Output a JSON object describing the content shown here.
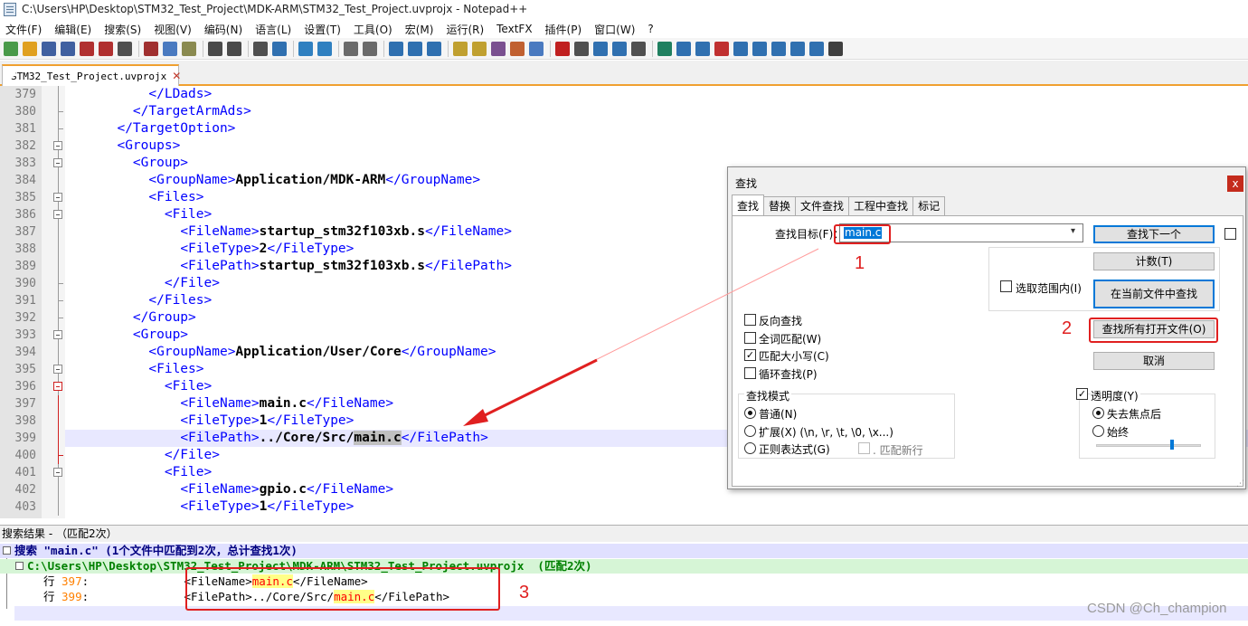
{
  "window": {
    "title": "C:\\Users\\HP\\Desktop\\STM32_Test_Project\\MDK-ARM\\STM32_Test_Project.uvprojx - Notepad++"
  },
  "menu": [
    "文件(F)",
    "编辑(E)",
    "搜索(S)",
    "视图(V)",
    "编码(N)",
    "语言(L)",
    "设置(T)",
    "工具(O)",
    "宏(M)",
    "运行(R)",
    "TextFX",
    "插件(P)",
    "窗口(W)",
    "?"
  ],
  "toolbar_icons": [
    "new-file-icon",
    "open-folder-icon",
    "save-icon",
    "save-all-icon",
    "close-icon",
    "close-all-icon",
    "print-icon",
    "cut-icon",
    "copy-icon",
    "paste-icon",
    "undo-icon",
    "redo-icon",
    "find-icon",
    "replace-icon",
    "zoom-in-icon",
    "zoom-out-icon",
    "sync-v-icon",
    "sync-h-icon",
    "wrap-icon",
    "all-chars-icon",
    "indent-guide-icon",
    "udl-icon",
    "doc-map-icon",
    "function-list-icon",
    "folder-as-workspace-icon",
    "monitor-icon",
    "record-macro-icon",
    "stop-macro-icon",
    "play-macro-icon",
    "run-macro-icon",
    "save-macro-icon",
    "plugin-icon",
    "insert-icon",
    "list-icon",
    "list2-icon",
    "collapse-icon",
    "up-icon",
    "down-icon",
    "sort-icon",
    "columns-icon",
    "hex-icon"
  ],
  "tab": {
    "label": "STM32_Test_Project.uvprojx"
  },
  "editor": {
    "lines": [
      {
        "num": "379",
        "indent": "      ",
        "pre": "",
        "open": "</LDads>",
        "text": "",
        "close": ""
      },
      {
        "num": "380",
        "indent": "    ",
        "pre": "",
        "open": "</TargetArmAds>",
        "text": "",
        "close": ""
      },
      {
        "num": "381",
        "indent": "  ",
        "pre": "",
        "open": "</TargetOption>",
        "text": "",
        "close": ""
      },
      {
        "num": "382",
        "indent": "  ",
        "pre": "",
        "open": "<Groups>",
        "text": "",
        "close": ""
      },
      {
        "num": "383",
        "indent": "    ",
        "pre": "",
        "open": "<Group>",
        "text": "",
        "close": ""
      },
      {
        "num": "384",
        "indent": "      ",
        "pre": "",
        "open": "<GroupName>",
        "text": "Application/MDK-ARM",
        "close": "</GroupName>"
      },
      {
        "num": "385",
        "indent": "      ",
        "pre": "",
        "open": "<Files>",
        "text": "",
        "close": ""
      },
      {
        "num": "386",
        "indent": "        ",
        "pre": "",
        "open": "<File>",
        "text": "",
        "close": ""
      },
      {
        "num": "387",
        "indent": "          ",
        "pre": "",
        "open": "<FileName>",
        "text": "startup_stm32f103xb.s",
        "close": "</FileName>"
      },
      {
        "num": "388",
        "indent": "          ",
        "pre": "",
        "open": "<FileType>",
        "text": "2",
        "close": "</FileType>"
      },
      {
        "num": "389",
        "indent": "          ",
        "pre": "",
        "open": "<FilePath>",
        "text": "startup_stm32f103xb.s",
        "close": "</FilePath>"
      },
      {
        "num": "390",
        "indent": "        ",
        "pre": "",
        "open": "</File>",
        "text": "",
        "close": ""
      },
      {
        "num": "391",
        "indent": "      ",
        "pre": "",
        "open": "</Files>",
        "text": "",
        "close": ""
      },
      {
        "num": "392",
        "indent": "    ",
        "pre": "",
        "open": "</Group>",
        "text": "",
        "close": ""
      },
      {
        "num": "393",
        "indent": "    ",
        "pre": "",
        "open": "<Group>",
        "text": "",
        "close": ""
      },
      {
        "num": "394",
        "indent": "      ",
        "pre": "",
        "open": "<GroupName>",
        "text": "Application/User/Core",
        "close": "</GroupName>"
      },
      {
        "num": "395",
        "indent": "      ",
        "pre": "",
        "open": "<Files>",
        "text": "",
        "close": ""
      },
      {
        "num": "396",
        "indent": "        ",
        "pre": "",
        "open": "<File>",
        "text": "",
        "close": ""
      },
      {
        "num": "397",
        "indent": "          ",
        "pre": "",
        "open": "<FileName>",
        "text": "main.c",
        "close": "</FileName>"
      },
      {
        "num": "398",
        "indent": "          ",
        "pre": "",
        "open": "<FileType>",
        "text": "1",
        "close": "</FileType>"
      },
      {
        "num": "399",
        "indent": "          ",
        "pre": "",
        "open": "<FilePath>",
        "text": "../Core/Src/",
        "close": "</FilePath>",
        "sel": "main.c"
      },
      {
        "num": "400",
        "indent": "        ",
        "pre": "",
        "open": "</File>",
        "text": "",
        "close": ""
      },
      {
        "num": "401",
        "indent": "        ",
        "pre": "",
        "open": "<File>",
        "text": "",
        "close": ""
      },
      {
        "num": "402",
        "indent": "          ",
        "pre": "",
        "open": "<FileName>",
        "text": "gpio.c",
        "close": "</FileName>"
      },
      {
        "num": "403",
        "indent": "          ",
        "pre": "",
        "open": "<FileType>",
        "text": "1",
        "close": "</FileType>"
      }
    ]
  },
  "results": {
    "header": "搜索结果 - （匹配2次）",
    "search_line": "搜索 \"main.c\" (1个文件中匹配到2次，总计查找1次)",
    "file_line": "C:\\Users\\HP\\Desktop\\STM32_Test_Project\\MDK-ARM\\STM32_Test_Project.uvprojx  (匹配2次)",
    "hits": [
      {
        "prefix": "行 ",
        "num": "397",
        "colon": ":",
        "pad": "              ",
        "before": "<FileName>",
        "match": "main.c",
        "after": "</FileName>"
      },
      {
        "prefix": "行 ",
        "num": "399",
        "colon": ":",
        "pad": "              ",
        "before": "<FilePath>../Core/Src/",
        "match": "main.c",
        "after": "</FilePath>"
      }
    ]
  },
  "dialog": {
    "title": "查找",
    "close": "x",
    "tabs": [
      "查找",
      "替换",
      "文件查找",
      "工程中查找",
      "标记"
    ],
    "target_label": "查找目标(F)：",
    "target_value": "main.c",
    "buttons": {
      "find_next": "查找下一个",
      "count": "计数(T)",
      "find_in_current": "在当前文件中查找",
      "find_all_open": "查找所有打开文件(O)",
      "cancel": "取消"
    },
    "in_selection": "选取范围内(I)",
    "options": [
      {
        "label": "反向查找",
        "checked": false
      },
      {
        "label": "全词匹配(W)",
        "checked": false
      },
      {
        "label": "匹配大小写(C)",
        "checked": true
      },
      {
        "label": "循环查找(P)",
        "checked": false
      }
    ],
    "mode_title": "查找模式",
    "modes": [
      {
        "label": "普通(N)",
        "on": true
      },
      {
        "label": "扩展(X) (\\n, \\r, \\t, \\0, \\x...)",
        "on": false
      },
      {
        "label": "正则表达式(G)",
        "on": false
      }
    ],
    "dot_newline": ". 匹配新行",
    "transparency_label": "透明度(Y)",
    "transparency_checked": true,
    "transparency_modes": [
      {
        "label": "失去焦点后",
        "on": true
      },
      {
        "label": "始终",
        "on": false
      }
    ]
  },
  "annotations": [
    "1",
    "2",
    "3"
  ],
  "watermark": "CSDN @Ch_champion"
}
